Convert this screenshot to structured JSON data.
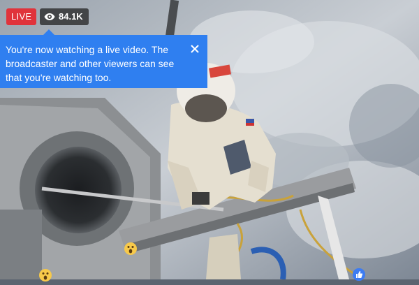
{
  "live_badge": {
    "label": "LIVE",
    "color": "#e0333b"
  },
  "viewer_count": {
    "icon": "eye-icon",
    "value": "84.1K"
  },
  "tooltip": {
    "text": "You're now watching a live video. The broadcaster and other viewers can see that you're watching too.",
    "close_icon": "close-icon",
    "color": "#2f7ff0"
  },
  "reactions": [
    {
      "type": "wow",
      "icon": "wow-reaction-icon"
    },
    {
      "type": "wow",
      "icon": "wow-reaction-icon"
    },
    {
      "type": "like",
      "icon": "like-reaction-icon"
    }
  ]
}
